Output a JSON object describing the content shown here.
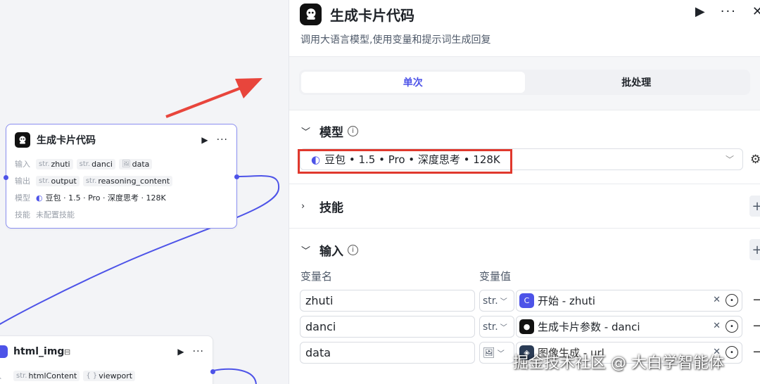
{
  "canvas": {
    "node1": {
      "title": "生成卡片代码",
      "input_label": "输入",
      "inputs": [
        {
          "type": "str.",
          "name": "zhuti"
        },
        {
          "type": "str.",
          "name": "danci"
        },
        {
          "type": "img",
          "name": "data"
        }
      ],
      "output_label": "输出",
      "outputs": [
        {
          "type": "str.",
          "name": "output"
        },
        {
          "type": "str.",
          "name": "reasoning_content"
        }
      ],
      "model_label": "模型",
      "model": "豆包 · 1.5 · Pro · 深度思考 · 128K",
      "skill_label": "技能",
      "skill": "未配置技能"
    },
    "node2": {
      "title": "html_img",
      "input_label": "入",
      "inputs": [
        {
          "type": "str.",
          "name": "htmlContent"
        },
        {
          "type": "{ }",
          "name": "viewport"
        }
      ]
    }
  },
  "panel": {
    "title": "生成卡片代码",
    "description": "调用大语言模型,使用变量和提示词生成回复",
    "tabs": [
      {
        "label": "单次",
        "active": true
      },
      {
        "label": "批处理",
        "active": false
      }
    ],
    "model_section": {
      "title": "模型",
      "value": "豆包 • 1.5 • Pro • 深度思考 • 128K"
    },
    "skills_section": {
      "title": "技能"
    },
    "input_section": {
      "title": "输入",
      "col_name": "变量名",
      "col_value": "变量值",
      "rows": [
        {
          "name": "zhuti",
          "type": "str.",
          "ref": "开始 - zhuti"
        },
        {
          "name": "danci",
          "type": "str.",
          "ref": "生成卡片参数 - danci"
        },
        {
          "name": "data",
          "type": "img",
          "ref": "图像生成 - url"
        }
      ]
    }
  },
  "watermark": "掘金技术社区 @ 大白学智能体",
  "colors": {
    "accent": "#4d53e8",
    "highlight_red": "#e0382d",
    "arrow_red": "#e8453c"
  }
}
